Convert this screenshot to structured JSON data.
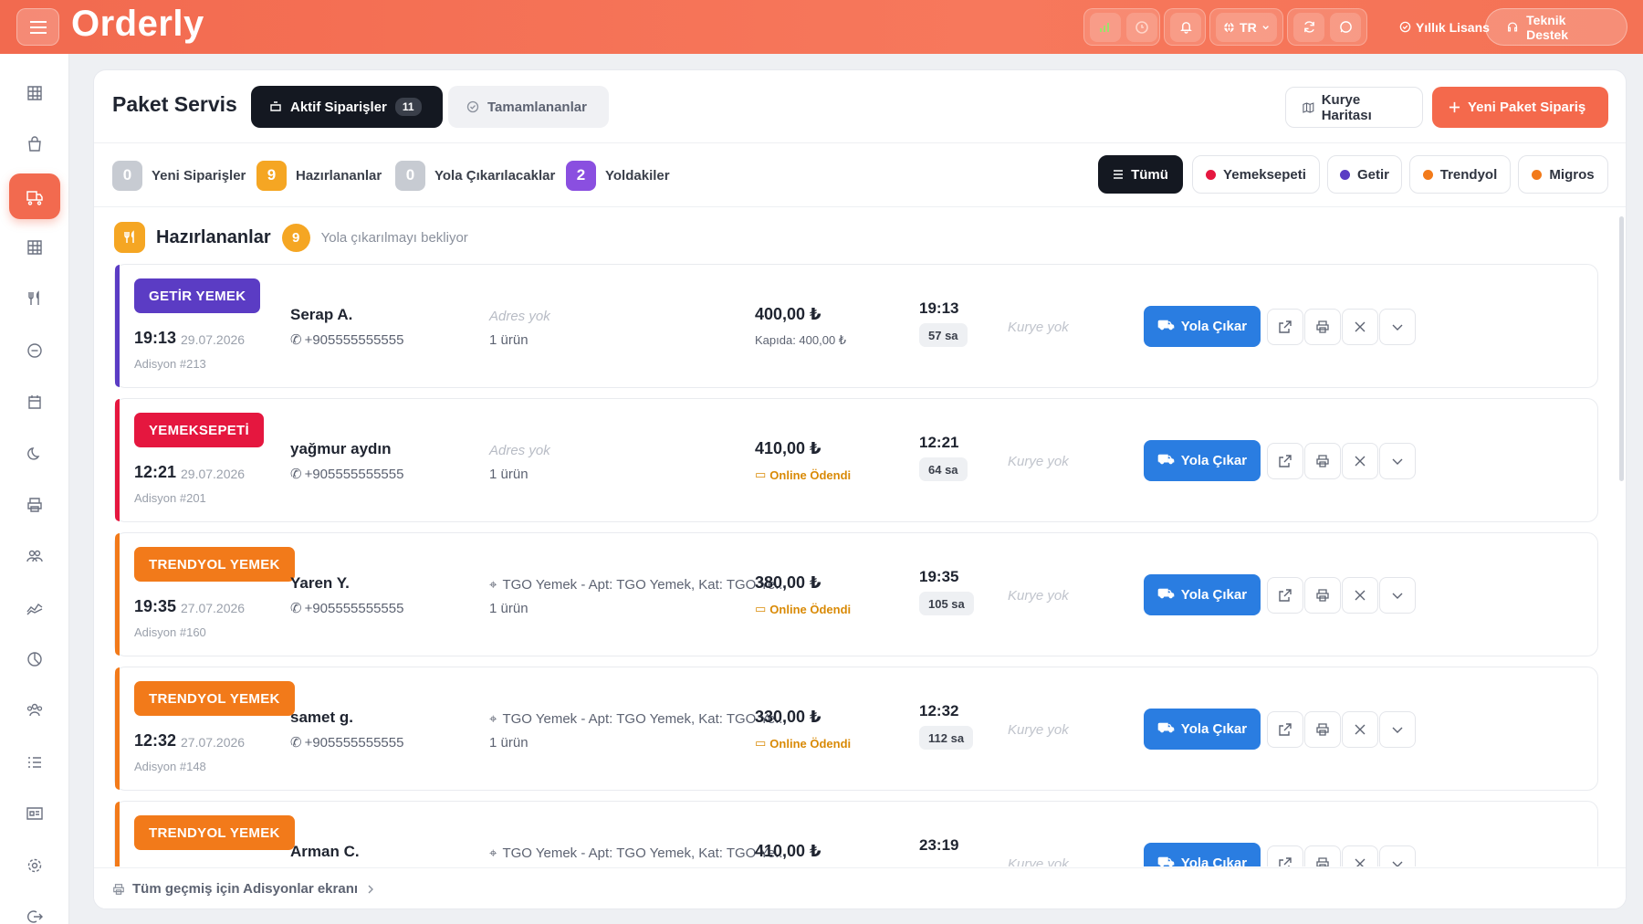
{
  "app": {
    "logo": "Orderly"
  },
  "topbar": {
    "lang": "TR",
    "license_label": "Yıllık Lisans",
    "support_label": "Teknik Destek"
  },
  "page": {
    "title": "Paket Servis",
    "tab_active_label": "Aktif Siparişler",
    "tab_active_count": "11",
    "tab_done_label": "Tamamlananlar",
    "courier_map_label": "Kurye Haritası",
    "new_order_label": "Yeni Paket Sipariş"
  },
  "stats": [
    {
      "num": "0",
      "label": "Yeni Siparişler",
      "color": "#c7cbd2"
    },
    {
      "num": "9",
      "label": "Hazırlananlar",
      "color": "#f5a623"
    },
    {
      "num": "0",
      "label": "Yola Çıkarılacaklar",
      "color": "#c7cbd2"
    },
    {
      "num": "2",
      "label": "Yoldakiler",
      "color": "#8a4fe0"
    }
  ],
  "filters": [
    {
      "label": "Tümü",
      "color": ""
    },
    {
      "label": "Yemeksepeti",
      "color": "#e5173f"
    },
    {
      "label": "Getir",
      "color": "#5b3cc4"
    },
    {
      "label": "Trendyol",
      "color": "#f27a1a"
    },
    {
      "label": "Migros",
      "color": "#f27a1a"
    }
  ],
  "section": {
    "title": "Hazırlananlar",
    "count": "9",
    "subtitle": "Yola çıkarılmayı bekliyor"
  },
  "orders": [
    {
      "platform": "GETİR YEMEK",
      "color": "#5b3cc4",
      "time": "19:13",
      "date": "29.07.2026",
      "ticket": "Adisyon #213",
      "name": "Serap A.",
      "phone": "+905555555555",
      "address": "Adres yok",
      "items": "1 ürün",
      "price": "400,00 ₺",
      "payment": "Kapıda: 400,00 ₺",
      "est_time": "19:13",
      "duration": "57 sa",
      "courier": "Kurye yok",
      "action": "Yola Çıkar"
    },
    {
      "platform": "YEMEKSEPETİ",
      "color": "#e5173f",
      "time": "12:21",
      "date": "29.07.2026",
      "ticket": "Adisyon #201",
      "name": "yağmur aydın",
      "phone": "+905555555555",
      "address": "Adres yok",
      "items": "1 ürün",
      "price": "410,00 ₺",
      "payment": "Online Ödendi",
      "est_time": "12:21",
      "duration": "64 sa",
      "courier": "Kurye yok",
      "action": "Yola Çıkar"
    },
    {
      "platform": "TRENDYOL YEMEK",
      "color": "#f27a1a",
      "time": "19:35",
      "date": "27.07.2026",
      "ticket": "Adisyon #160",
      "name": "Yaren Y.",
      "phone": "+905555555555",
      "address": "TGO Yemek - Apt: TGO Yemek, Kat: TGO Ye...",
      "items": "1 ürün",
      "price": "380,00 ₺",
      "payment": "Online Ödendi",
      "est_time": "19:35",
      "duration": "105 sa",
      "courier": "Kurye yok",
      "action": "Yola Çıkar"
    },
    {
      "platform": "TRENDYOL YEMEK",
      "color": "#f27a1a",
      "time": "12:32",
      "date": "27.07.2026",
      "ticket": "Adisyon #148",
      "name": "samet g.",
      "phone": "+905555555555",
      "address": "TGO Yemek - Apt: TGO Yemek, Kat: TGO Ye...",
      "items": "1 ürün",
      "price": "330,00 ₺",
      "payment": "Online Ödendi",
      "est_time": "12:32",
      "duration": "112 sa",
      "courier": "Kurye yok",
      "action": "Yola Çıkar"
    },
    {
      "platform": "TRENDYOL YEMEK",
      "color": "#f27a1a",
      "time": "",
      "date": "",
      "ticket": "",
      "name": "Arman C.",
      "phone": "",
      "address": "TGO Yemek - Apt: TGO Yemek, Kat: TGO Ye...",
      "items": "",
      "price": "410,00 ₺",
      "payment": "",
      "est_time": "23:19",
      "duration": "",
      "courier": "Kurye yok",
      "action": "Yola Çıkar"
    }
  ],
  "footer": {
    "label": "Tüm geçmiş için Adisyonlar ekranı"
  },
  "sidebar_icons": [
    "grid-icon",
    "bag-icon",
    "truck-icon",
    "table-icon",
    "utensils-icon",
    "minus-circle-icon",
    "calendar-icon",
    "moon-icon",
    "printer-icon",
    "users-icon",
    "chart-icon",
    "pie-chart-icon",
    "team-icon",
    "list-icon",
    "id-card-icon",
    "settings-icon",
    "logout-icon"
  ]
}
